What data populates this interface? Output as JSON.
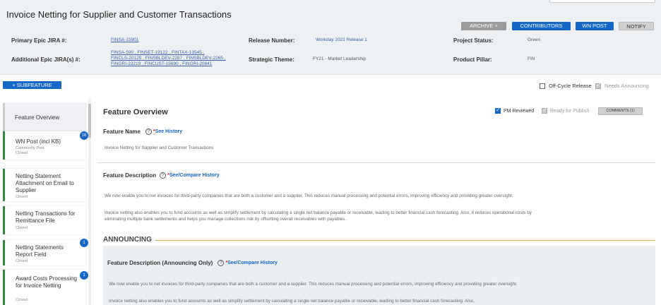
{
  "header": {
    "title": "Invoice Netting for Supplier and Customer Transactions",
    "buttons": {
      "archive": "ARCHIVE ˅",
      "contributors": "CONTRIBUTORS",
      "wn_post": "WN POST",
      "notify": "NOTIFY"
    },
    "fields": {
      "primary_epic_label": "Primary Epic JIRA #:",
      "primary_epic_value": "FINSA-15901",
      "additional_epic_label": "Additional Epic JIRA(s) #:",
      "additional_epic_line1": "FINSA-590 , FINSET-19122 , FINTAX-13545 ,",
      "additional_epic_line2": "FINCLS-20125 , FINSBLDEV-2287 , FINSBLDEV-2265 ,",
      "additional_epic_line3": "FINGRI-23219 , FINCUST-15690 , FINGRI-20841",
      "release_label": "Release Number:",
      "release_value": "Workday 2021 Release 1",
      "theme_label": "Strategic Theme:",
      "theme_value": "FY21 - Market Leadership",
      "status_label": "Project Status:",
      "status_value": "Green",
      "pillar_label": "Product Pillar:",
      "pillar_value": "FIN"
    }
  },
  "toolbar": {
    "subfeature_label": "+ SUBFEATURE",
    "off_cycle_label": "Off-Cycle Release",
    "needs_announcing_label": "Needs Announcing"
  },
  "sidebar": {
    "items": [
      {
        "name": "Feature Overview",
        "sub": "",
        "status": ""
      },
      {
        "name": "WN Post (incl KB)",
        "sub": "Community Post",
        "status": "Closed",
        "badge": "16"
      },
      {
        "name": "Netting Statement Attachment on Email to Supplier",
        "sub": "",
        "status": "Closed"
      },
      {
        "name": "Netting Transactions for Remittance File",
        "sub": "",
        "status": "Closed"
      },
      {
        "name": "Netting Statements Report Field",
        "sub": "",
        "status": "Closed",
        "badge": "1"
      },
      {
        "name": "Award Costs Processing for Invoice Netting",
        "sub": "",
        "status": "Closed",
        "badge": "1"
      }
    ]
  },
  "main": {
    "section_title": "Feature Overview",
    "pm_reviewed": "PM Reviewed",
    "ready_for_publish": "Ready for Publish",
    "comments": "COMMENTS (1)",
    "feature_name_label": "Feature Name",
    "see_history": "See History",
    "feature_name_value": "Invoice Netting for Supplier and Customer Transactions",
    "feature_desc_label": "Feature Description",
    "see_compare_history": "See/Compare History",
    "desc_p1": "We now enable you to net invoices for third-party companies that are both a customer and a supplier. This reduces manual processing and potential errors, improving efficiency and providing greater oversight.",
    "desc_p2": "Invoice netting also enables you to fund accounts as well as simplify settlement by calculating a single net balance payable or receivable, leading to better financial cash forecasting. Also, it reduces operational costs by eliminating multiple bank settlements and helps you manage collections risk by offsetting overall receivables with payables.",
    "announcing_title": "ANNOUNCING",
    "ann_desc_label": "Feature Description (Announcing Only)",
    "ann_p1": "We now enable you to net invoices for third-party companies that are both a customer and a supplier. This reduces manual processing and potential errors, improving efficiency and providing greater oversight.",
    "ann_p2": "Invoice netting also enables you to fund accounts as well as simplify settlement by calculating a single net balance payable or receivable, leading to better financial cash forecasting. Also,"
  },
  "icons": {
    "plus": "plus-icon",
    "help": "help-circle-icon",
    "check": "checkmark-icon",
    "chevron": "chevron-down-icon"
  },
  "colors": {
    "primary_blue": "#1466c7",
    "status_green": "#2e8b3e",
    "accent_orange": "#e0a85a",
    "required_red": "#e01f1f"
  }
}
